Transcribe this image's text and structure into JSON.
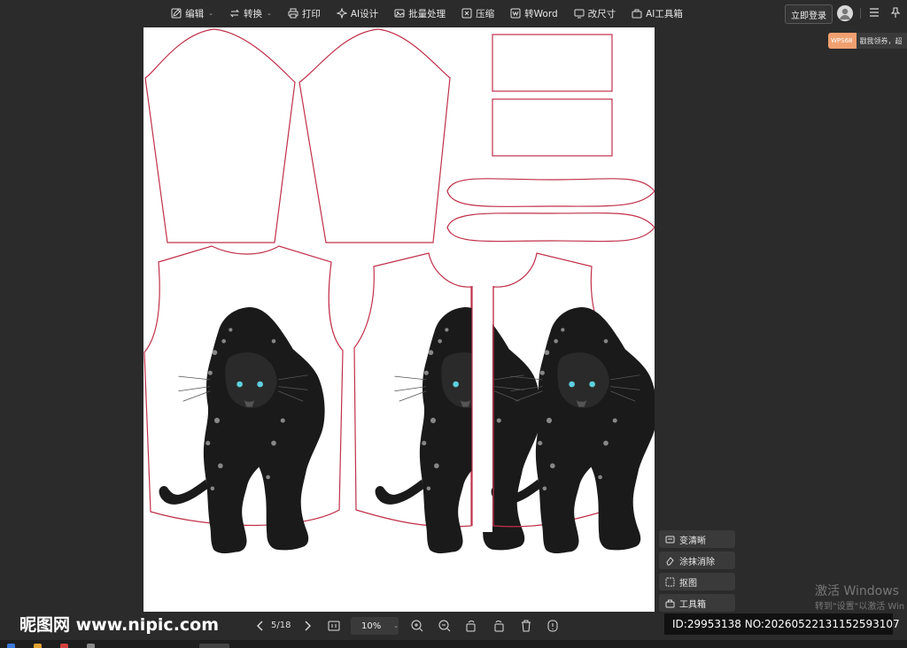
{
  "toolbar": {
    "items": [
      {
        "label": "编辑",
        "icon": "edit-icon",
        "has_caret": true
      },
      {
        "label": "转换",
        "icon": "convert-icon",
        "has_caret": true
      },
      {
        "label": "打印",
        "icon": "print-icon"
      },
      {
        "label": "AI设计",
        "icon": "ai-design-icon"
      },
      {
        "label": "批量处理",
        "icon": "batch-icon"
      },
      {
        "label": "压缩",
        "icon": "compress-icon"
      },
      {
        "label": "转Word",
        "icon": "word-icon"
      },
      {
        "label": "改尺寸",
        "icon": "resize-icon"
      },
      {
        "label": "AI工具箱",
        "icon": "ai-toolbox-icon"
      }
    ],
    "login_label": "立即登录"
  },
  "promo": {
    "tag": "WPS68",
    "text": "戳我领券，超"
  },
  "side_tools": [
    {
      "label": "变清晰",
      "icon": "enhance-icon"
    },
    {
      "label": "涂抹消除",
      "icon": "eraser-icon"
    },
    {
      "label": "抠图",
      "icon": "cutout-icon"
    },
    {
      "label": "工具箱",
      "icon": "toolbox-icon"
    }
  ],
  "watermark": {
    "line1": "激活 Windows",
    "line2": "转到\"设置\"以激活 Win"
  },
  "bottom": {
    "site": "昵图网 www.nipic.com",
    "page_indicator": "5/18",
    "zoom": "10%",
    "id_text": "ID:29953138 NO:20260522131152593107"
  },
  "colors": {
    "background": "#2b2b2b",
    "page": "#ffffff",
    "pattern_outline": "#c0304a",
    "promo": "#f0a070"
  }
}
